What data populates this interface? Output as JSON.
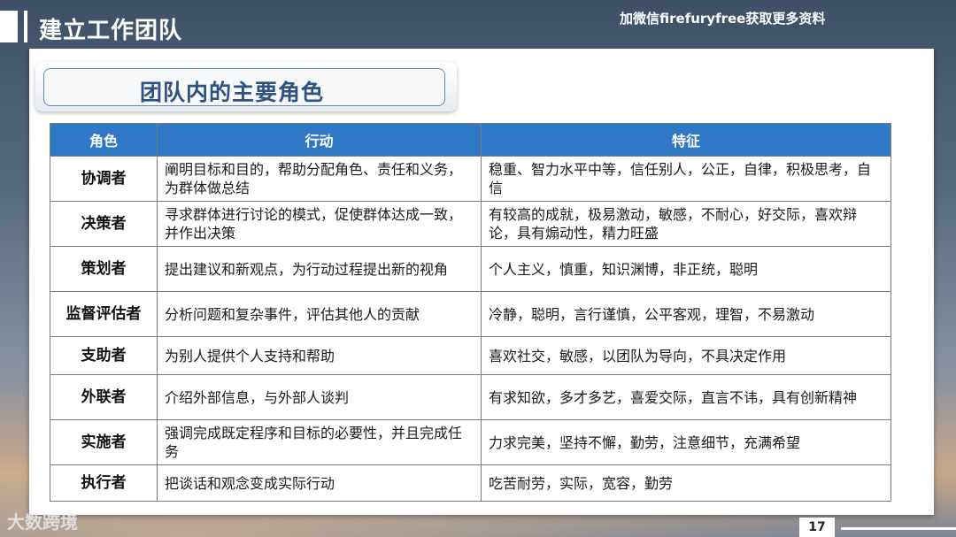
{
  "slide": {
    "title": "建立工作团队",
    "watermark": "加微信firefuryfree获取更多资料",
    "subtitle": "团队内的主要角色",
    "footer_logo": "大数跨境",
    "page_number": "17"
  },
  "table": {
    "headers": [
      "角色",
      "行动",
      "特征"
    ],
    "rows": [
      {
        "role": "协调者",
        "action": "阐明目标和目的，帮助分配角色、责任和义务，为群体做总结",
        "traits": "稳重、智力水平中等，信任别人，公正，自律，积极思考，自信"
      },
      {
        "role": "决策者",
        "action": "寻求群体进行讨论的模式，促使群体达成一致，并作出决策",
        "traits": "有较高的成就，极易激动，敏感，不耐心，好交际，喜欢辩论，具有煽动性，精力旺盛"
      },
      {
        "role": "策划者",
        "action": "提出建议和新观点，为行动过程提出新的视角",
        "traits": "个人主义，慎重，知识渊博，非正统，聪明"
      },
      {
        "role": "监督评估者",
        "action": "分析问题和复杂事件，评估其他人的贡献",
        "traits": "冷静，聪明，言行谨慎，公平客观，理智，不易激动"
      },
      {
        "role": "支助者",
        "action": "为别人提供个人支持和帮助",
        "traits": "喜欢社交，敏感，以团队为导向，不具决定作用"
      },
      {
        "role": "外联者",
        "action": "介绍外部信息，与外部人谈判",
        "traits": "有求知欲，多才多艺，喜爱交际，直言不讳，具有创新精神"
      },
      {
        "role": "实施者",
        "action": "强调完成既定程序和目标的必要性，并且完成任务",
        "traits": "力求完美，坚持不懈，勤劳，注意细节，充满希望"
      },
      {
        "role": "执行者",
        "action": "把谈话和观念变成实际行动",
        "traits": "吃苦耐劳，实际，宽容，勤劳"
      }
    ]
  }
}
